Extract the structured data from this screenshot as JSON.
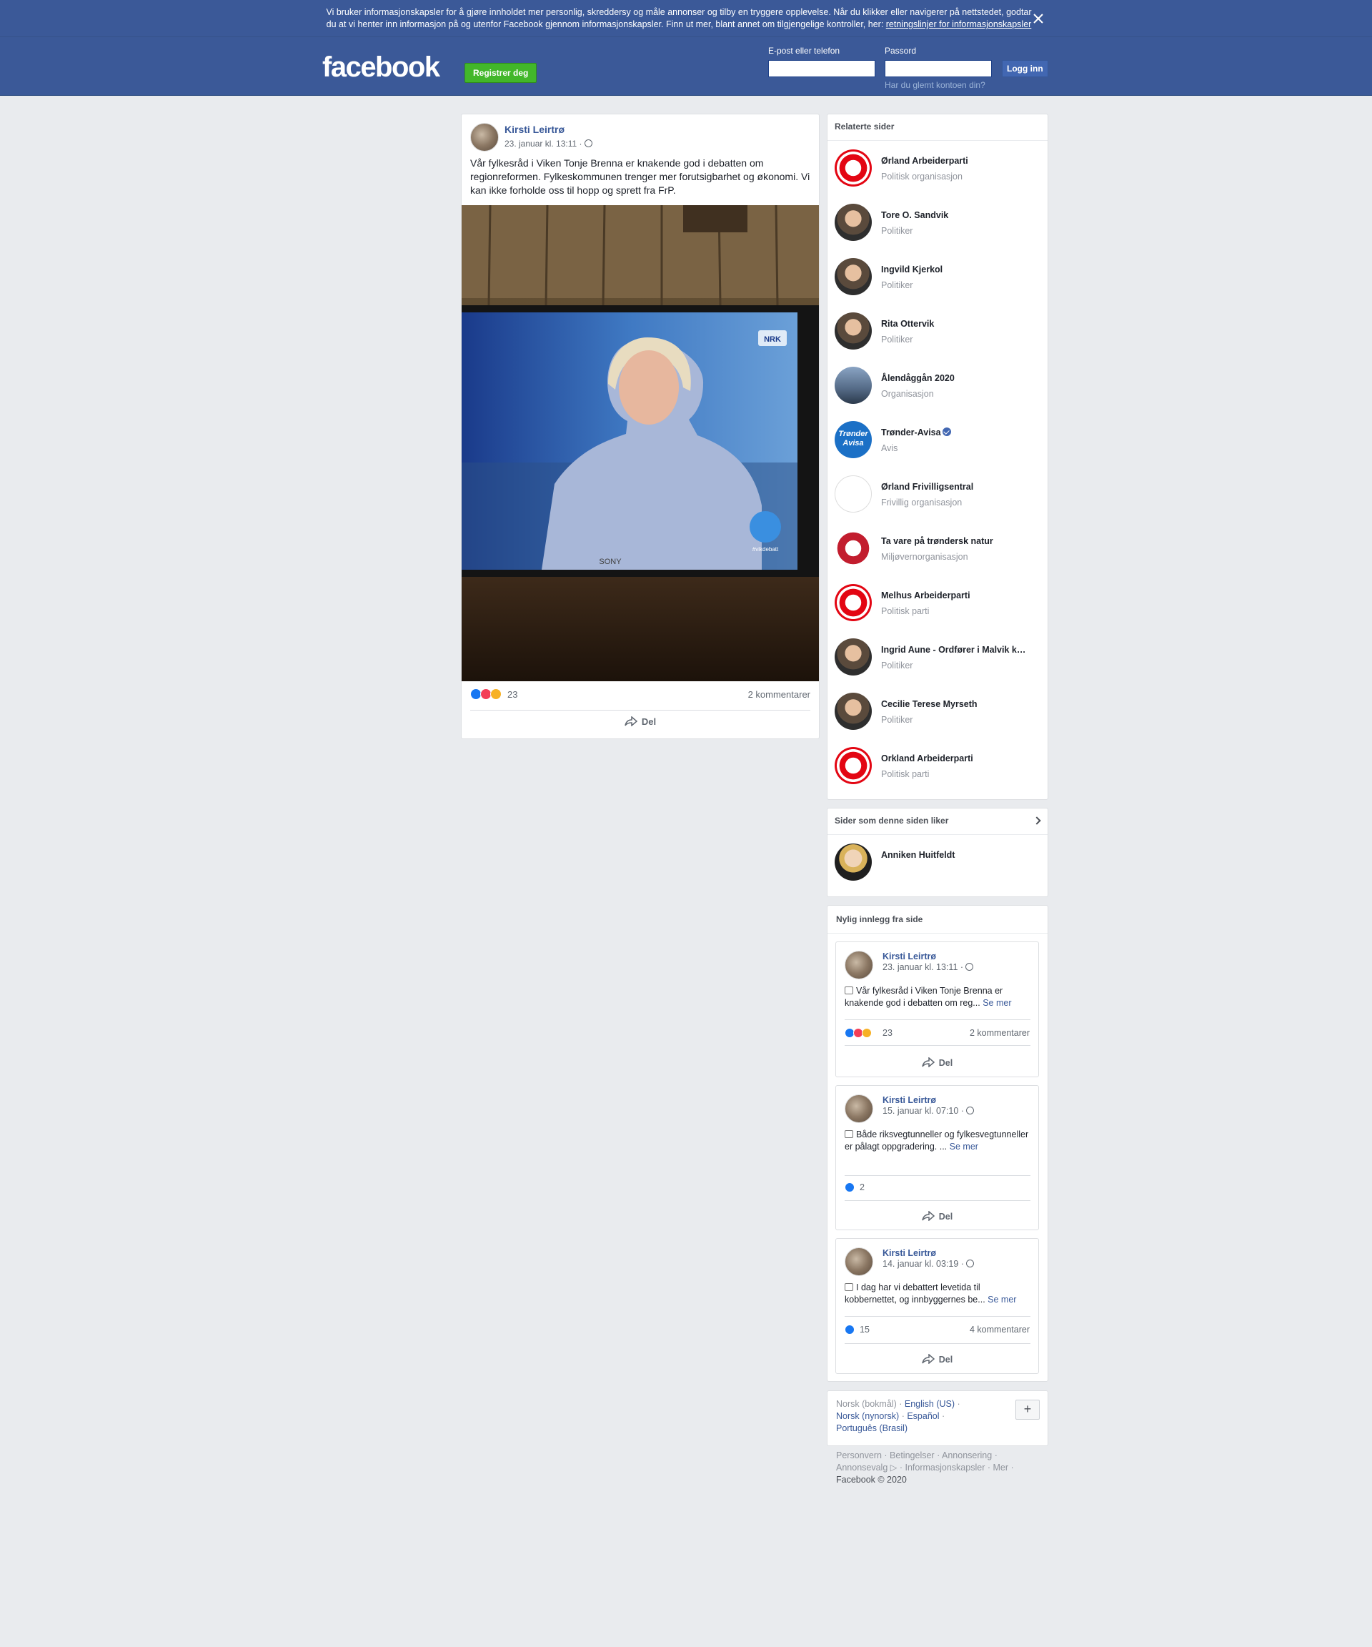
{
  "cookie_banner": {
    "text": "Vi bruker informasjonskapsler for å gjøre innholdet mer personlig, skreddersy og måle annonser og tilby en tryggere opplevelse. Når du klikker eller navigerer på nettstedet, godtar du at vi henter inn informasjon på og utenfor Facebook gjennom informasjonskapsler. Finn ut mer, blant annet om tilgjengelige kontroller, her: ",
    "link": "retningslinjer for informasjonskapsler"
  },
  "header": {
    "logo": "facebook",
    "register": "Registrer deg",
    "email_label": "E-post eller telefon",
    "password_label": "Passord",
    "login": "Logg inn",
    "forgot": "Har du glemt kontoen din?"
  },
  "main_post": {
    "author": "Kirsti Leirtrø",
    "time": "23. januar kl. 13:11 ·",
    "text": "Vår fylkesråd i Viken Tonje Brenna er knakende god i debatten om regionreformen. Fylkeskommunen trenger mer forutsigbarhet og økonomi. Vi kan ikke forholde oss til hopp og sprett fra FrP.",
    "reaction_count": "23",
    "comments": "2 kommentarer",
    "share": "Del",
    "image_overlay": {
      "brand": "SONY",
      "channel": "NRK",
      "hashtag": "#vikdebatt"
    }
  },
  "related": {
    "title": "Relaterte sider",
    "items": [
      {
        "name": "Ørland Arbeiderparti",
        "category": "Politisk organisasjon",
        "icon": "rose-logo"
      },
      {
        "name": "Tore O. Sandvik",
        "category": "Politiker",
        "icon": "person-photo"
      },
      {
        "name": "Ingvild Kjerkol",
        "category": "Politiker",
        "icon": "person-photo"
      },
      {
        "name": "Rita Ottervik",
        "category": "Politiker",
        "icon": "person-photo"
      },
      {
        "name": "Ålendåggån 2020",
        "category": "Organisasjon",
        "icon": "city-photo"
      },
      {
        "name": "Trønder-Avisa",
        "category": "Avis",
        "icon": "tronder-avisa-logo",
        "verified": true,
        "logo_text": "Trønder Avisa"
      },
      {
        "name": "Ørland Frivilligsentral",
        "category": "Frivillig organisasjon",
        "icon": "frivillig-logo"
      },
      {
        "name": "Ta vare på trøndersk natur",
        "category": "Miljøvernorganisasjon",
        "icon": "nature-logo"
      },
      {
        "name": "Melhus Arbeiderparti",
        "category": "Politisk parti",
        "icon": "rose-logo"
      },
      {
        "name": "Ingrid Aune - Ordfører i Malvik k…",
        "category": "Politiker",
        "icon": "person-photo"
      },
      {
        "name": "Cecilie Terese Myrseth",
        "category": "Politiker",
        "icon": "person-photo"
      },
      {
        "name": "Orkland Arbeiderparti",
        "category": "Politisk parti",
        "icon": "rose-logo"
      }
    ]
  },
  "likes": {
    "title": "Sider som denne siden liker",
    "items": [
      {
        "name": "Anniken Huitfeldt",
        "icon": "person-photo"
      }
    ]
  },
  "recent": {
    "title": "Nylig innlegg fra side",
    "posts": [
      {
        "author": "Kirsti Leirtrø",
        "time": "23. januar kl. 13:11 ·",
        "text": "Vår fylkesråd i Viken Tonje Brenna er knakende god i debatten om reg...",
        "more": "Se mer",
        "reactions": "23",
        "comments": "2 kommentarer",
        "share": "Del",
        "icon": "tv-emoji"
      },
      {
        "author": "Kirsti Leirtrø",
        "time": "15. januar kl. 07:10 ·",
        "text": "Både riksvegtunneller og fylkesvegtunneller er pålagt oppgradering. ...",
        "more": "Se mer",
        "reactions": "2",
        "comments": "",
        "share": "Del",
        "icon": "chart-emoji"
      },
      {
        "author": "Kirsti Leirtrø",
        "time": "14. januar kl. 03:19 ·",
        "text": "I dag har vi debattert levetida til kobbernettet, og innbyggernes be...",
        "more": "Se mer",
        "reactions": "15",
        "comments": "4 kommentarer",
        "share": "Del",
        "icon": "computer-emoji"
      }
    ]
  },
  "languages": {
    "current": "Norsk (bokmål)",
    "links": [
      "English (US)",
      "Norsk (nynorsk)",
      "Español",
      "Português (Brasil)"
    ],
    "plus": "+"
  },
  "footer": {
    "links": [
      "Personvern",
      "Betingelser",
      "Annonsering",
      "Annonsevalg",
      "Informasjonskapsler",
      "Mer"
    ],
    "copyright": "Facebook © 2020"
  }
}
